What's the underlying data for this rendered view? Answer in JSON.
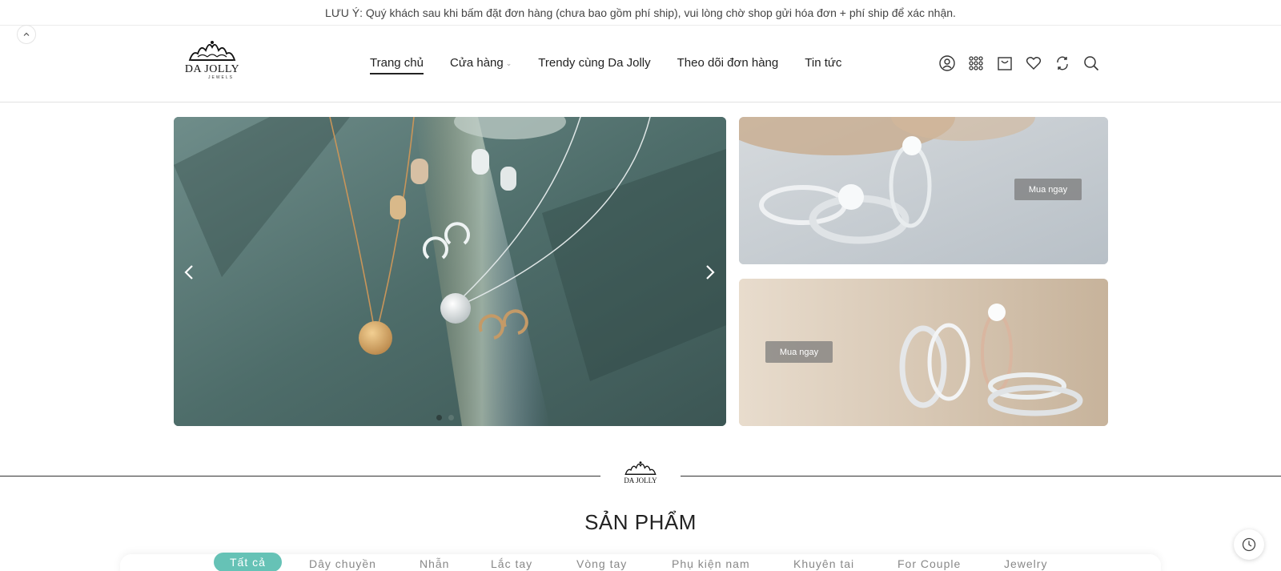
{
  "notice": "LƯU Ý: Quý khách sau khi bấm đặt đơn hàng (chưa bao gồm phí ship), vui lòng chờ shop gửi hóa đơn + phí ship để xác nhận.",
  "brand": {
    "name": "DA JOLLY",
    "sub": "JEWELS"
  },
  "nav": {
    "items": [
      {
        "label": "Trang chủ",
        "active": true
      },
      {
        "label": "Cửa hàng",
        "dropdown": true
      },
      {
        "label": "Trendy cùng Da Jolly"
      },
      {
        "label": "Theo dõi đơn hàng"
      },
      {
        "label": "Tin tức"
      }
    ]
  },
  "header_icons": [
    "user-icon",
    "grid-icon",
    "cart-icon",
    "heart-icon",
    "compare-icon",
    "search-icon"
  ],
  "slider": {
    "slide_count": 2,
    "active_slide": 1
  },
  "banners": [
    {
      "button": "Mua ngay"
    },
    {
      "button": "Mua ngay"
    }
  ],
  "products": {
    "title": "SẢN PHẨM",
    "tabs": [
      {
        "label": "Tất cả",
        "active": true
      },
      {
        "label": "Dây chuyền"
      },
      {
        "label": "Nhẫn"
      },
      {
        "label": "Lắc tay"
      },
      {
        "label": "Vòng tay"
      },
      {
        "label": "Phụ kiện nam"
      },
      {
        "label": "Khuyên tai"
      },
      {
        "label": "For Couple"
      },
      {
        "label": "Jewelry"
      }
    ]
  },
  "colors": {
    "accent": "#66c2b6",
    "text": "#222222"
  }
}
